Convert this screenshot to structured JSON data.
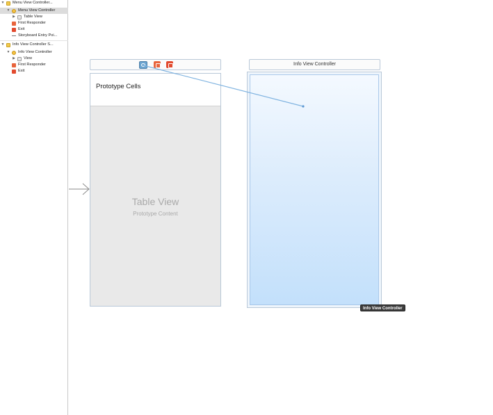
{
  "outline": {
    "items": [
      {
        "label": "Menu View Controller...",
        "icon": "scene-icon",
        "disclosure": "▼",
        "indent": 0
      },
      {
        "label": "Menu View Controller",
        "icon": "view-controller-icon",
        "disclosure": "▼",
        "indent": 1,
        "selected": true
      },
      {
        "label": "Table View",
        "icon": "table-view-icon",
        "disclosure": "▶",
        "indent": 2
      },
      {
        "label": "First Responder",
        "icon": "first-responder-icon",
        "disclosure": "",
        "indent": 1
      },
      {
        "label": "Exit",
        "icon": "exit-icon",
        "disclosure": "",
        "indent": 1
      },
      {
        "label": "Storyboard Entry Poi...",
        "icon": "entry-arrow-icon",
        "disclosure": "",
        "indent": 1
      },
      {
        "label": "Info View Controller S...",
        "icon": "scene-icon",
        "disclosure": "▼",
        "indent": 0
      },
      {
        "label": "Info View Controller",
        "icon": "view-controller-icon",
        "disclosure": "▼",
        "indent": 1
      },
      {
        "label": "View",
        "icon": "view-icon",
        "disclosure": "▶",
        "indent": 2
      },
      {
        "label": "First Responder",
        "icon": "first-responder-icon",
        "disclosure": "",
        "indent": 1
      },
      {
        "label": "Exit",
        "icon": "exit-icon",
        "disclosure": "",
        "indent": 1
      }
    ]
  },
  "menu_scene": {
    "proto_cells_label": "Prototype Cells",
    "table_view_title": "Table View",
    "table_view_subtitle": "Prototype Content"
  },
  "info_scene": {
    "title": "Info View Controller",
    "tooltip": "Info View Controller"
  },
  "colors": {
    "accent": "#6aa3cf",
    "segue_line": "#7fb3e0",
    "info_gradient_bottom": "#c3e0fb"
  }
}
